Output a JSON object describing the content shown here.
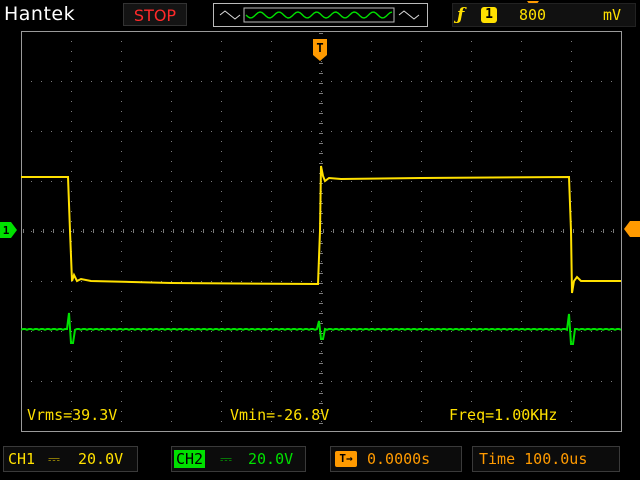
{
  "header": {
    "brand": "Hantek",
    "run_status": "STOP",
    "trigger": {
      "edge_icon": "rising-edge-icon",
      "source": "1",
      "level": "800",
      "unit": "mV"
    }
  },
  "markers": {
    "trigger_position": "T",
    "ch1_ground": "1"
  },
  "measurements": {
    "vrms": "Vrms=39.3V",
    "vmin": "Vmin=-26.8V",
    "freq": "Freq=1.00KHz"
  },
  "status_bar": {
    "ch1": {
      "label": "CH1",
      "coupling": "⎓",
      "scale": "20.0V"
    },
    "ch2": {
      "label": "CH2",
      "coupling": "⎓",
      "scale": "20.0V"
    },
    "offset": {
      "icon": "T→",
      "value": "0.0000s"
    },
    "timebase": "Time 100.0us"
  },
  "colors": {
    "ch1": "#ffe000",
    "ch2": "#00e000",
    "trigger": "#ff9a00",
    "grid": "#7a7a7a",
    "stop": "#ff2a2a"
  }
}
